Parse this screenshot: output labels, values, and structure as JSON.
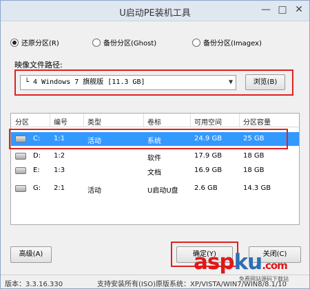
{
  "window": {
    "title": "U启动PE装机工具",
    "controls": {
      "min": "—",
      "max": "□",
      "close": "✕"
    }
  },
  "options": [
    {
      "label": "还原分区(R)",
      "checked": true
    },
    {
      "label": "备份分区(Ghost)",
      "checked": false
    },
    {
      "label": "备份分区(Imagex)",
      "checked": false
    }
  ],
  "image_path": {
    "label": "映像文件路径:",
    "selected": "└ 4 Windows 7 旗舰版 [11.3 GB]",
    "browse": "浏览(B)"
  },
  "table": {
    "headers": [
      "分区",
      "编号",
      "类型",
      "卷标",
      "可用空间",
      "分区容量"
    ],
    "rows": [
      {
        "part": "C:",
        "num": "1:1",
        "type": "活动",
        "label": "系统",
        "free": "24.9 GB",
        "size": "25 GB",
        "selected": true
      },
      {
        "part": "D:",
        "num": "1:2",
        "type": "",
        "label": "软件",
        "free": "17.9 GB",
        "size": "18 GB",
        "selected": false
      },
      {
        "part": "E:",
        "num": "1:3",
        "type": "",
        "label": "文档",
        "free": "16.9 GB",
        "size": "18 GB",
        "selected": false
      },
      {
        "part": "G:",
        "num": "2:1",
        "type": "活动",
        "label": "U启动U盘",
        "free": "2.6 GB",
        "size": "14.3 GB",
        "selected": false
      }
    ]
  },
  "buttons": {
    "advanced": "高级(A)",
    "confirm": "确定(Y)",
    "close": "关闭(C)"
  },
  "status": {
    "version": "版本：3.3.16.330",
    "support": "支持安装所有(ISO)原版系统：XP/VISTA/WIN7/WIN8/8.1/10"
  },
  "watermark": {
    "asp": "asp",
    "ku": "ku",
    "com": ".com",
    "sub": "免费网站源码下载站"
  },
  "colors": {
    "selection": "#3399ff",
    "highlight_box": "#e02020"
  }
}
